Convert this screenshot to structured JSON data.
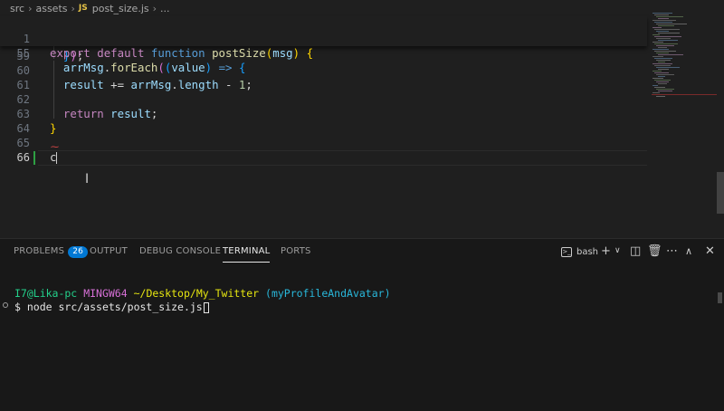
{
  "breadcrumb": {
    "items": [
      "src",
      "assets"
    ],
    "file_icon": "JS",
    "file": "post_size.js",
    "tail": "..."
  },
  "editor": {
    "sticky": [
      {
        "num": "1",
        "parts": [
          {
            "t": "export",
            "c": "ctl"
          },
          {
            "t": " ",
            "c": ""
          },
          {
            "t": "default",
            "c": "ctl"
          },
          {
            "t": " ",
            "c": ""
          },
          {
            "t": "function",
            "c": "kw"
          },
          {
            "t": " ",
            "c": ""
          },
          {
            "t": "postSize",
            "c": "fn"
          },
          {
            "t": "(",
            "c": "br1"
          },
          {
            "t": "msg",
            "c": "var"
          },
          {
            "t": ")",
            "c": "br1"
          },
          {
            "t": " ",
            "c": ""
          },
          {
            "t": "{",
            "c": "br1"
          }
        ]
      },
      {
        "num": "55",
        "parts": [
          {
            "t": "  ",
            "c": ""
          },
          {
            "t": "arrMsg",
            "c": "var"
          },
          {
            "t": ".",
            "c": "op"
          },
          {
            "t": "forEach",
            "c": "fn"
          },
          {
            "t": "(",
            "c": "br2"
          },
          {
            "t": "(",
            "c": "br3"
          },
          {
            "t": "value",
            "c": "var"
          },
          {
            "t": ")",
            "c": "br3"
          },
          {
            "t": " ",
            "c": ""
          },
          {
            "t": "=>",
            "c": "kw"
          },
          {
            "t": " ",
            "c": ""
          },
          {
            "t": "{",
            "c": "br3"
          }
        ]
      }
    ],
    "lines": [
      {
        "num": "59",
        "parts": [
          {
            "t": "  ",
            "c": ""
          },
          {
            "t": "}",
            "c": "br3"
          },
          {
            "t": ")",
            "c": "br2"
          },
          {
            "t": ";",
            "c": "op"
          }
        ]
      },
      {
        "num": "60",
        "parts": []
      },
      {
        "num": "61",
        "parts": [
          {
            "t": "  ",
            "c": ""
          },
          {
            "t": "result",
            "c": "var"
          },
          {
            "t": " += ",
            "c": "op"
          },
          {
            "t": "arrMsg",
            "c": "var"
          },
          {
            "t": ".",
            "c": "op"
          },
          {
            "t": "length",
            "c": "var"
          },
          {
            "t": " - ",
            "c": "op"
          },
          {
            "t": "1",
            "c": "num"
          },
          {
            "t": ";",
            "c": "op"
          }
        ]
      },
      {
        "num": "62",
        "parts": []
      },
      {
        "num": "63",
        "parts": [
          {
            "t": "  ",
            "c": ""
          },
          {
            "t": "return",
            "c": "ctl"
          },
          {
            "t": " ",
            "c": ""
          },
          {
            "t": "result",
            "c": "var"
          },
          {
            "t": ";",
            "c": "op"
          }
        ]
      },
      {
        "num": "64",
        "parts": [
          {
            "t": "}",
            "c": "br1"
          }
        ]
      },
      {
        "num": "65",
        "parts": []
      },
      {
        "num": "66",
        "parts": [
          {
            "t": "c",
            "c": "op"
          }
        ],
        "active": true
      }
    ]
  },
  "panel": {
    "tabs": [
      {
        "label": "PROBLEMS",
        "badge": "26"
      },
      {
        "label": "OUTPUT"
      },
      {
        "label": "DEBUG CONSOLE"
      },
      {
        "label": "TERMINAL",
        "active": true
      },
      {
        "label": "PORTS"
      }
    ],
    "shell": "bash",
    "terminal": {
      "user_host": "I7@Lika-pc",
      "env": "MINGW64",
      "path": "~/Desktop/My_Twitter",
      "branch": "(myProfileAndAvatar)",
      "prompt": "$",
      "command": "node src/assets/post_size.js"
    }
  },
  "icons": {
    "chevron": "chevron-right-icon",
    "terminal": "terminal-icon",
    "add": "plus-icon",
    "dropdown": "chevron-down-icon",
    "split": "split-icon",
    "trash": "trash-icon",
    "more": "ellipsis-icon",
    "maximize": "chevron-up-icon",
    "close": "close-icon"
  },
  "colors": {
    "editor_bg": "#1f1f1f",
    "panel_bg": "#181818",
    "accent": "#0078d4",
    "git_added": "#2ea043"
  }
}
